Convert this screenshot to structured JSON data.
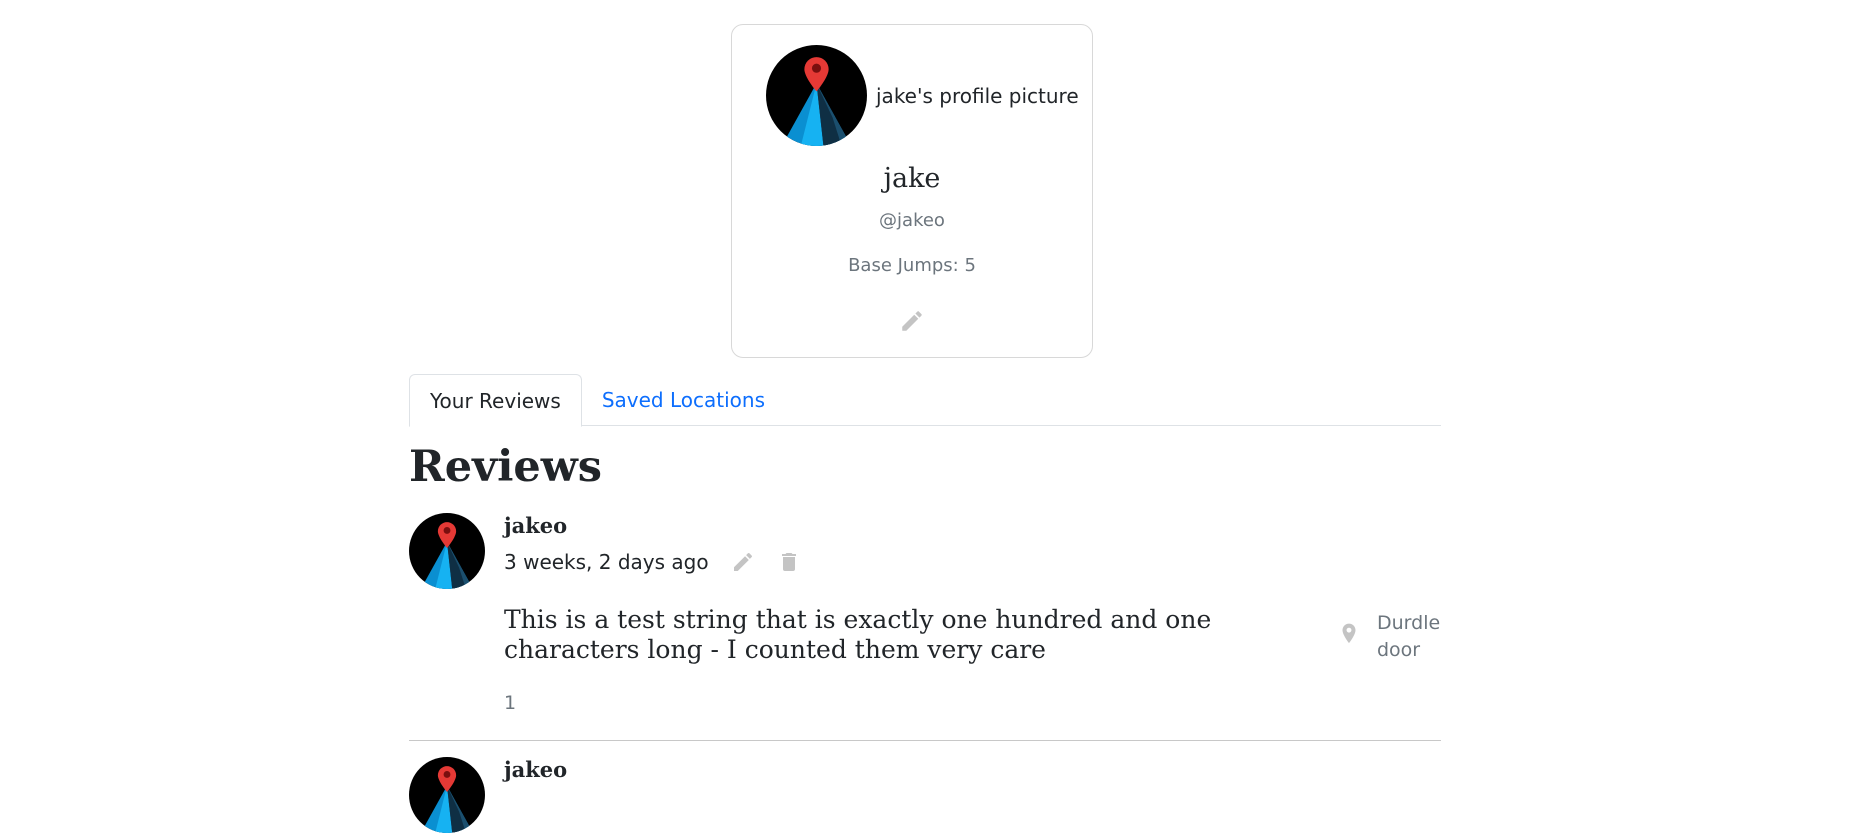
{
  "profile": {
    "avatar_alt": "jake's profile picture",
    "name": "jake",
    "handle": "@jakeo",
    "base_jumps": "Base Jumps: 5",
    "edit_icon": "pencil-icon"
  },
  "tabs": [
    {
      "label": "Your Reviews",
      "active": true
    },
    {
      "label": "Saved Locations",
      "active": false
    }
  ],
  "reviews_heading": "Reviews",
  "reviews": [
    {
      "author": "jakeo",
      "time": "3 weeks, 2 days ago",
      "text": "This is a test string that is exactly one hundred and one characters long - I counted them very care",
      "location": "Durdle door",
      "count": "1"
    },
    {
      "author": "jakeo"
    }
  ],
  "colors": {
    "link": "#0d6efd",
    "muted": "#6c757d",
    "icon": "#c4c4c4",
    "pin_red": "#e53935",
    "mountain_blue": "#1aa7ec"
  }
}
